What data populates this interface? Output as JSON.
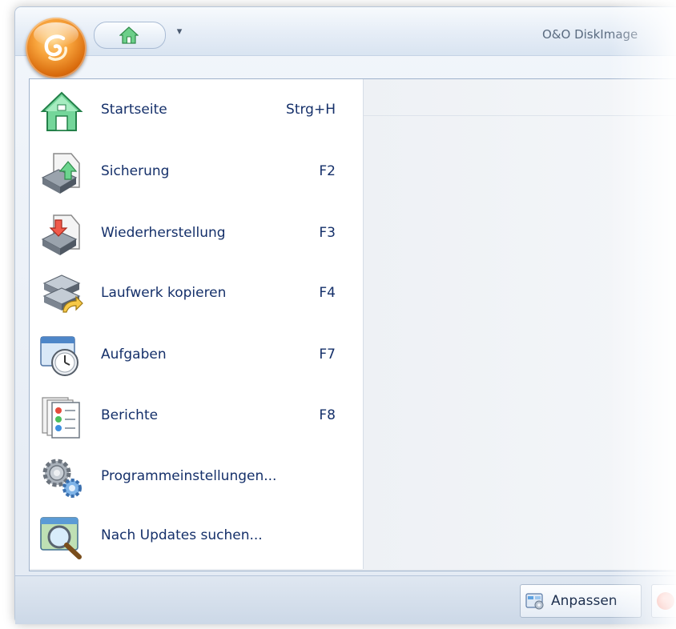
{
  "window": {
    "title": "O&O DiskImage",
    "app_button_icon": "oo-orb-icon",
    "quick_access": {
      "home_icon": "home-icon",
      "dropdown_icon": "chevron-down-icon"
    }
  },
  "menu": {
    "items": [
      {
        "label": "Startseite",
        "shortcut": "Strg+H",
        "icon": "home-icon"
      },
      {
        "label": "Sicherung",
        "shortcut": "F2",
        "icon": "backup-icon"
      },
      {
        "label": "Wiederherstellung",
        "shortcut": "F3",
        "icon": "restore-icon"
      },
      {
        "label": "Laufwerk kopieren",
        "shortcut": "F4",
        "icon": "drive-copy-icon"
      },
      {
        "label": "Aufgaben",
        "shortcut": "F7",
        "icon": "tasks-clock-icon"
      },
      {
        "label": "Berichte",
        "shortcut": "F8",
        "icon": "reports-icon"
      },
      {
        "label": "Programmeinstellungen...",
        "shortcut": "",
        "icon": "settings-gears-icon"
      },
      {
        "label": "Nach Updates suchen...",
        "shortcut": "",
        "icon": "update-search-icon"
      }
    ]
  },
  "statusbar": {
    "anpassen_label": "Anpassen",
    "anpassen_icon": "customize-icon",
    "next_icon": "exit-icon"
  },
  "colors": {
    "menu_text": "#15306a",
    "orb": "#f7a23a",
    "frame": "#dfe7f1"
  }
}
